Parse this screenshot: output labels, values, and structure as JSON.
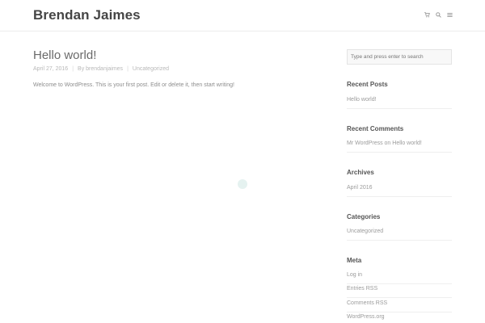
{
  "header": {
    "site_title": "Brendan Jaimes",
    "icons": [
      "cart-icon",
      "search-icon",
      "menu-icon"
    ]
  },
  "post": {
    "title": "Hello world!",
    "date": "April 27, 2016",
    "author": "By brendanjaimes",
    "category": "Uncategorized",
    "excerpt": "Welcome to WordPress. This is your first post. Edit or delete it, then start writing!"
  },
  "sidebar": {
    "search_placeholder": "Type and press enter to search",
    "recent_posts": {
      "title": "Recent Posts",
      "items": [
        "Hello world!"
      ]
    },
    "recent_comments": {
      "title": "Recent Comments",
      "items": [
        "Mr WordPress on Hello world!"
      ]
    },
    "archives": {
      "title": "Archives",
      "items": [
        "April 2016"
      ]
    },
    "categories": {
      "title": "Categories",
      "items": [
        "Uncategorized"
      ]
    },
    "meta": {
      "title": "Meta",
      "items": [
        "Log in",
        "Entries RSS",
        "Comments RSS",
        "WordPress.org"
      ]
    }
  },
  "colors": {
    "accent_loader": "#e5f2f0",
    "title": "#454545"
  }
}
